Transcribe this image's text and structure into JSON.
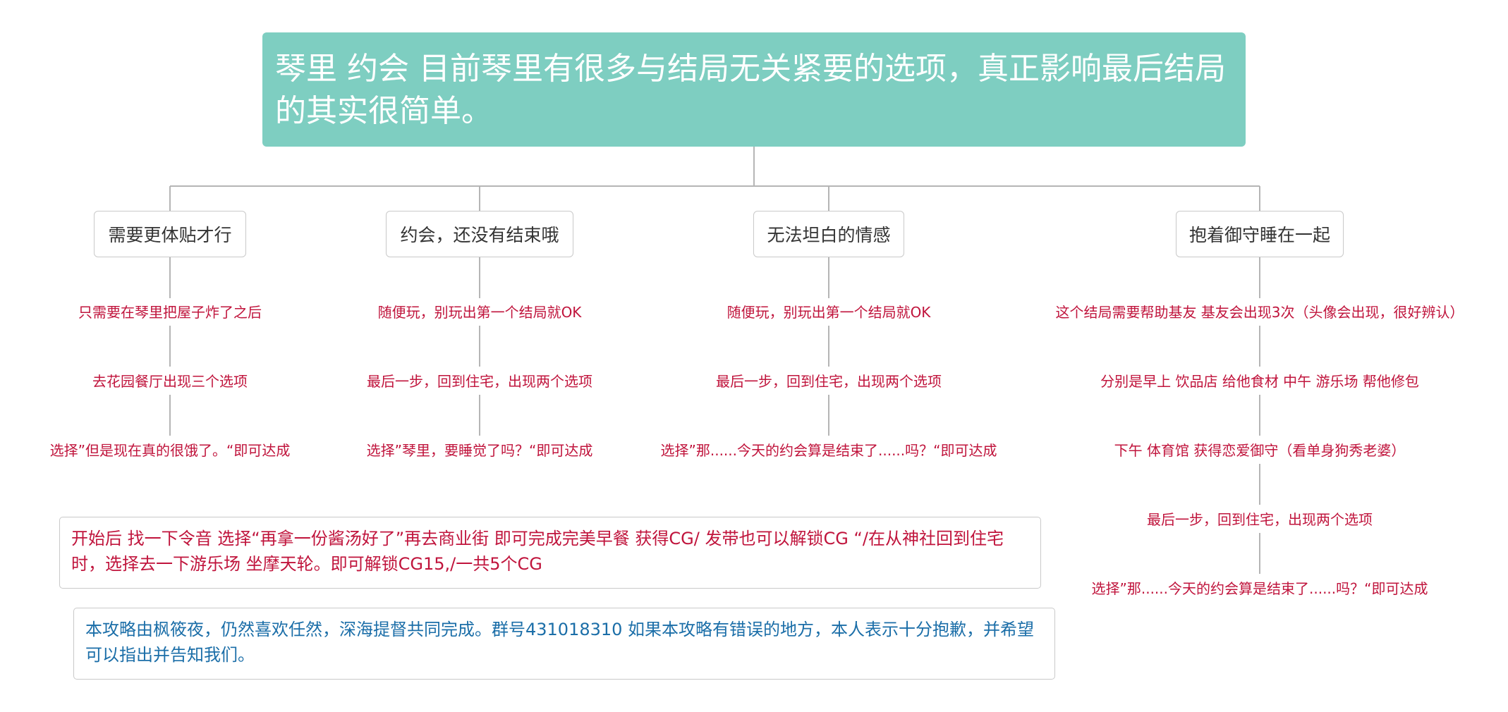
{
  "root": {
    "title": "琴里 约会 目前琴里有很多与结局无关紧要的选项，真正影响最后结局的其实很简单。"
  },
  "branches": [
    {
      "label": "需要更体贴才行",
      "items": [
        "只需要在琴里把屋子炸了之后",
        "去花园餐厅出现三个选项",
        "选择”但是现在真的很饿了。“即可达成"
      ]
    },
    {
      "label": "约会，还没有结束哦",
      "items": [
        "随便玩，别玩出第一个结局就OK",
        "最后一步，回到住宅，出现两个选项",
        "选择”琴里，要睡觉了吗？“即可达成"
      ]
    },
    {
      "label": "无法坦白的情感",
      "items": [
        "随便玩，别玩出第一个结局就OK",
        "最后一步，回到住宅，出现两个选项",
        "选择”那......今天的约会算是结束了......吗？“即可达成"
      ]
    },
    {
      "label": "抱着御守睡在一起",
      "items": [
        "这个结局需要帮助基友 基友会出现3次（头像会出现，很好辨认）",
        "分别是早上 饮品店 给他食材 中午 游乐场 帮他修包",
        "下午 体育馆 获得恋爱御守（看单身狗秀老婆）",
        "最后一步，回到住宅，出现两个选项",
        "选择”那......今天的约会算是结束了......吗？“即可达成"
      ]
    }
  ],
  "notes": {
    "cg": "开始后 找一下令音 选择“再拿一份酱汤好了”再去商业街 即可完成完美早餐 获得CG/ 发带也可以解锁CG “/在从神社回到住宅时，选择去一下游乐场 坐摩天轮。即可解锁CG15,/一共5个CG",
    "credits": "本攻略由枫筱夜，仍然喜欢任然，深海提督共同完成。群号431018310 如果本攻略有错误的地方，本人表示十分抱歉，并希望可以指出并告知我们。"
  },
  "colors": {
    "root_bg": "#7ecec1",
    "leaf_text": "#c0143c",
    "credits_text": "#1b6ea8",
    "connector": "#b5b5b5"
  }
}
